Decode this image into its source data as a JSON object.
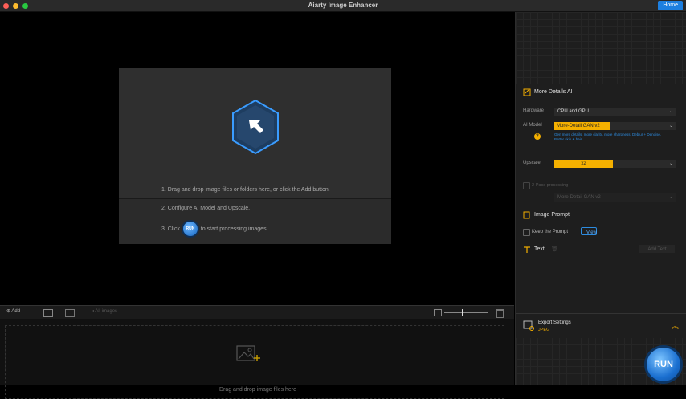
{
  "window": {
    "title": "Aiarty Image Enhancer",
    "home_label": "Home"
  },
  "drop_card": {
    "step1": "1. Drag and drop image files or folders here, or click the Add button.",
    "step2": "2. Configure AI Model and Upscale.",
    "step3_prefix": "3. Click",
    "step3_button": "RUN",
    "step3_suffix": "to start processing images."
  },
  "toolbar": {
    "add_label": "Add",
    "images_label": "All images"
  },
  "filmstrip": {
    "drop_text": "Drag and drop image files here"
  },
  "panel": {
    "section_title": "More Details AI",
    "hardware_label": "Hardware",
    "hardware_value": "CPU and GPU",
    "model_label": "AI Model",
    "model_value": "More-Detail GAN v2",
    "model_hint": "Gen more details, more clarity, more sharpness. Deblur + Denoise. Better skin & hair.",
    "upscale_label": "Upscale",
    "upscale_value": "x2",
    "twopass_label": "2-Pass processing",
    "twopass_model": "More-Detail GAN v2",
    "prompt_title": "Image Prompt",
    "keep_prompt": "Keep the Prompt",
    "view_label": "View",
    "text_title": "Text",
    "add_text_label": "Add Text",
    "export_title": "Export Settings",
    "export_format": "JPEG",
    "run_label": "RUN"
  },
  "colors": {
    "accent_blue": "#1d7fe0",
    "accent_yellow": "#f5b000"
  }
}
